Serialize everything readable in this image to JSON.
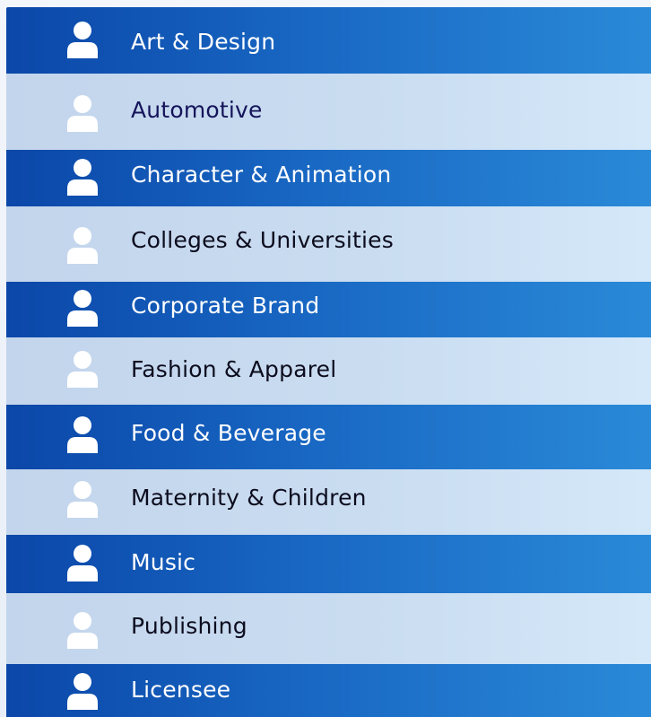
{
  "categories": [
    {
      "label": "Art & Design",
      "style": "dark",
      "icon": "user-icon"
    },
    {
      "label": "Automotive",
      "style": "light",
      "icon": "user-icon"
    },
    {
      "label": "Character & Animation",
      "style": "dark",
      "icon": "user-icon"
    },
    {
      "label": "Colleges & Universities",
      "style": "light",
      "icon": "user-icon"
    },
    {
      "label": "Corporate Brand",
      "style": "dark",
      "icon": "user-icon"
    },
    {
      "label": "Fashion & Apparel",
      "style": "light",
      "icon": "user-icon"
    },
    {
      "label": "Food & Beverage",
      "style": "dark",
      "icon": "user-icon"
    },
    {
      "label": "Maternity & Children",
      "style": "light",
      "icon": "user-icon"
    },
    {
      "label": "Music",
      "style": "dark",
      "icon": "user-icon"
    },
    {
      "label": "Publishing",
      "style": "light",
      "icon": "user-icon"
    },
    {
      "label": "Licensee",
      "style": "dark",
      "icon": "user-icon"
    }
  ],
  "colors": {
    "dark_row_start": "#0b47a8",
    "dark_row_end": "#2a8ad8",
    "light_row": "#c9dcf0",
    "icon": "#ffffff"
  }
}
